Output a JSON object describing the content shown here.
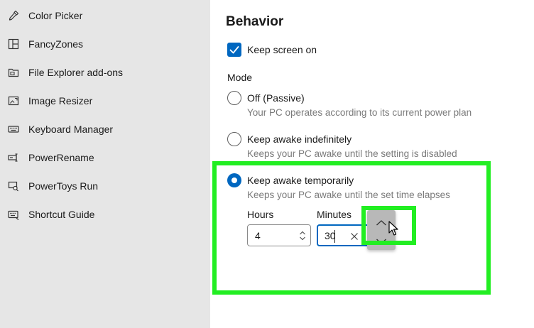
{
  "sidebar": {
    "items": [
      {
        "label": "Color Picker",
        "icon": "eyedropper-icon"
      },
      {
        "label": "FancyZones",
        "icon": "fancyzones-icon"
      },
      {
        "label": "File Explorer add-ons",
        "icon": "file-explorer-icon"
      },
      {
        "label": "Image Resizer",
        "icon": "image-resizer-icon"
      },
      {
        "label": "Keyboard Manager",
        "icon": "keyboard-icon"
      },
      {
        "label": "PowerRename",
        "icon": "rename-icon"
      },
      {
        "label": "PowerToys Run",
        "icon": "run-icon"
      },
      {
        "label": "Shortcut Guide",
        "icon": "shortcut-guide-icon"
      }
    ]
  },
  "behavior": {
    "title": "Behavior",
    "keep_screen_on": {
      "label": "Keep screen on",
      "checked": true
    },
    "mode_label": "Mode",
    "modes": [
      {
        "title": "Off (Passive)",
        "description": "Your PC operates according to its current power plan",
        "selected": false
      },
      {
        "title": "Keep awake indefinitely",
        "description": "Keeps your PC awake until the setting is disabled",
        "selected": false
      },
      {
        "title": "Keep awake temporarily",
        "description": "Keeps your PC awake until the set time elapses",
        "selected": true
      }
    ],
    "hours": {
      "label": "Hours",
      "value": "4"
    },
    "minutes": {
      "label": "Minutes",
      "value": "30"
    }
  },
  "colors": {
    "accent": "#0067c0",
    "sidebar_bg": "#e6e6e6",
    "highlight": "#22ee22"
  }
}
